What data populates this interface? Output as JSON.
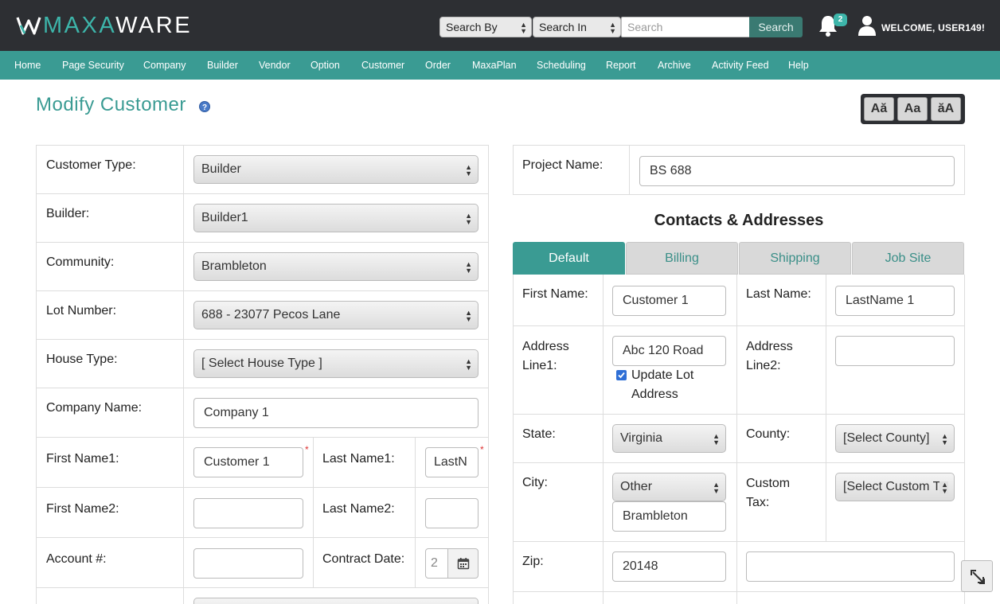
{
  "header": {
    "logo_maxa": "MAXA",
    "logo_ware": "WARE",
    "search_by": "Search By",
    "search_in": "Search In",
    "search_placeholder": "Search",
    "search_button": "Search",
    "notification_count": "2",
    "welcome": "WELCOME, USER149!"
  },
  "nav": [
    "Home",
    "Page Security",
    "Company",
    "Builder",
    "Vendor",
    "Option",
    "Customer",
    "Order",
    "MaxaPlan",
    "Scheduling",
    "Report",
    "Archive",
    "Activity Feed",
    "Help"
  ],
  "page": {
    "title": "Modify Customer",
    "font_buttons": [
      "Aă",
      "Aa",
      "ăA"
    ]
  },
  "left_form": {
    "customer_type": {
      "label": "Customer Type:",
      "value": "Builder"
    },
    "builder": {
      "label": "Builder:",
      "value": "Builder1"
    },
    "community": {
      "label": "Community:",
      "value": "Brambleton"
    },
    "lot_number": {
      "label": "Lot Number:",
      "value": "688 - 23077 Pecos Lane"
    },
    "house_type": {
      "label": "House Type:",
      "value": "[ Select House Type ]"
    },
    "company_name": {
      "label": "Company Name:",
      "value": "Company 1"
    },
    "first_name1": {
      "label": "First Name1:",
      "value": "Customer 1"
    },
    "last_name1": {
      "label": "Last Name1:",
      "value": "LastN"
    },
    "first_name2": {
      "label": "First Name2:",
      "value": ""
    },
    "last_name2": {
      "label": "Last Name2:",
      "value": ""
    },
    "account": {
      "label": "Account #:",
      "value": ""
    },
    "contract_date": {
      "label": "Contract Date:",
      "value": "2"
    },
    "required_mark": "*"
  },
  "right_form": {
    "project_name": {
      "label": "Project Name:",
      "value": "BS 688"
    },
    "section_title": "Contacts & Addresses",
    "tabs": [
      "Default",
      "Billing",
      "Shipping",
      "Job Site"
    ],
    "first_name": {
      "label": "First Name:",
      "value": "Customer 1"
    },
    "last_name": {
      "label": "Last Name:",
      "value": "LastName 1"
    },
    "address1": {
      "label_a": "Address",
      "label_b": "Line1:",
      "value": "Abc 120 Road"
    },
    "update_lot": {
      "line1": "Update Lot",
      "line2": "Address",
      "checked": true
    },
    "address2": {
      "label_a": "Address",
      "label_b": "Line2:",
      "value": ""
    },
    "state": {
      "label": "State:",
      "value": "Virginia"
    },
    "county": {
      "label": "County:",
      "value": "[Select County]"
    },
    "city": {
      "label": "City:",
      "value": "Other",
      "other_value": "Brambleton"
    },
    "custom_tax": {
      "label_a": "Custom",
      "label_b": "Tax:",
      "value": "[Select Custom T"
    },
    "zip": {
      "label": "Zip:",
      "value": "20148",
      "extra": ""
    }
  },
  "colors": {
    "header_bg": "#2d2f33",
    "accent": "#3a9b93",
    "brand_teal": "#3db5aa"
  }
}
